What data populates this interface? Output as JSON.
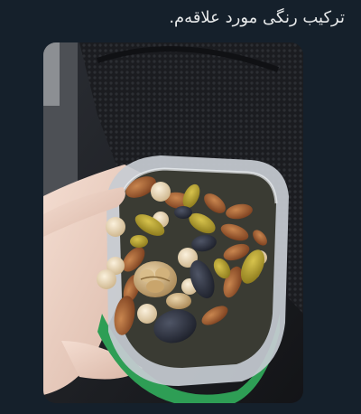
{
  "tweet": {
    "text": "ترکیب رنگی مورد علاقه‌م."
  },
  "media": {
    "kind": "photo",
    "subject": "hand-holding-container-of-mixed-nuts-and-dried-fruit",
    "colors": {
      "page_background": "#15202b",
      "text": "#e7e9ea",
      "container_lid": "#2e9e55"
    }
  }
}
